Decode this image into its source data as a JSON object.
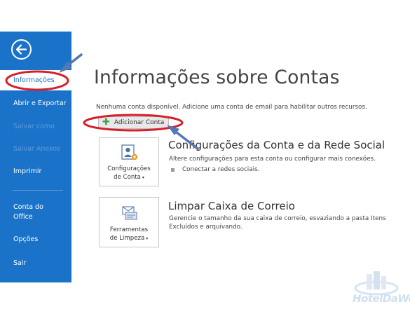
{
  "sidebar": {
    "items": [
      {
        "label": "Informações",
        "state": "active"
      },
      {
        "label": "Abrir e Exportar",
        "state": "normal"
      },
      {
        "label": "Salvar como",
        "state": "disabled"
      },
      {
        "label": "Salvar Anexos",
        "state": "disabled"
      },
      {
        "label": "Imprimir",
        "state": "normal"
      },
      {
        "label": "Conta do Office",
        "state": "normal"
      },
      {
        "label": "Opções",
        "state": "normal"
      },
      {
        "label": "Sair",
        "state": "normal"
      }
    ]
  },
  "main": {
    "title": "Informações sobre Contas",
    "no_account_text": "Nenhuma conta disponível. Adicione uma conta de email para habilitar outros recursos.",
    "add_account_label": "Adicionar Conta",
    "sections": [
      {
        "tile_label_line1": "Configurações",
        "tile_label_line2": "de Conta",
        "title": "Configurações da Conta e da Rede Social",
        "description": "Altere configurações para esta conta ou configurar mais conexões.",
        "bullet": "Conectar a redes sociais."
      },
      {
        "tile_label_line1": "Ferramentas",
        "tile_label_line2": "de Limpeza",
        "title": "Limpar Caixa de Correio",
        "description": "Gerencie o tamanho da sua caixa de correio, esvaziando a pasta Itens Excluídos e arquivando."
      }
    ]
  },
  "watermark": {
    "brand_line": "HotelDaWeb"
  },
  "colors": {
    "sidebar": "#1a73c9",
    "annotation_red": "#d4202a",
    "annotation_arrow": "#5577b3"
  }
}
